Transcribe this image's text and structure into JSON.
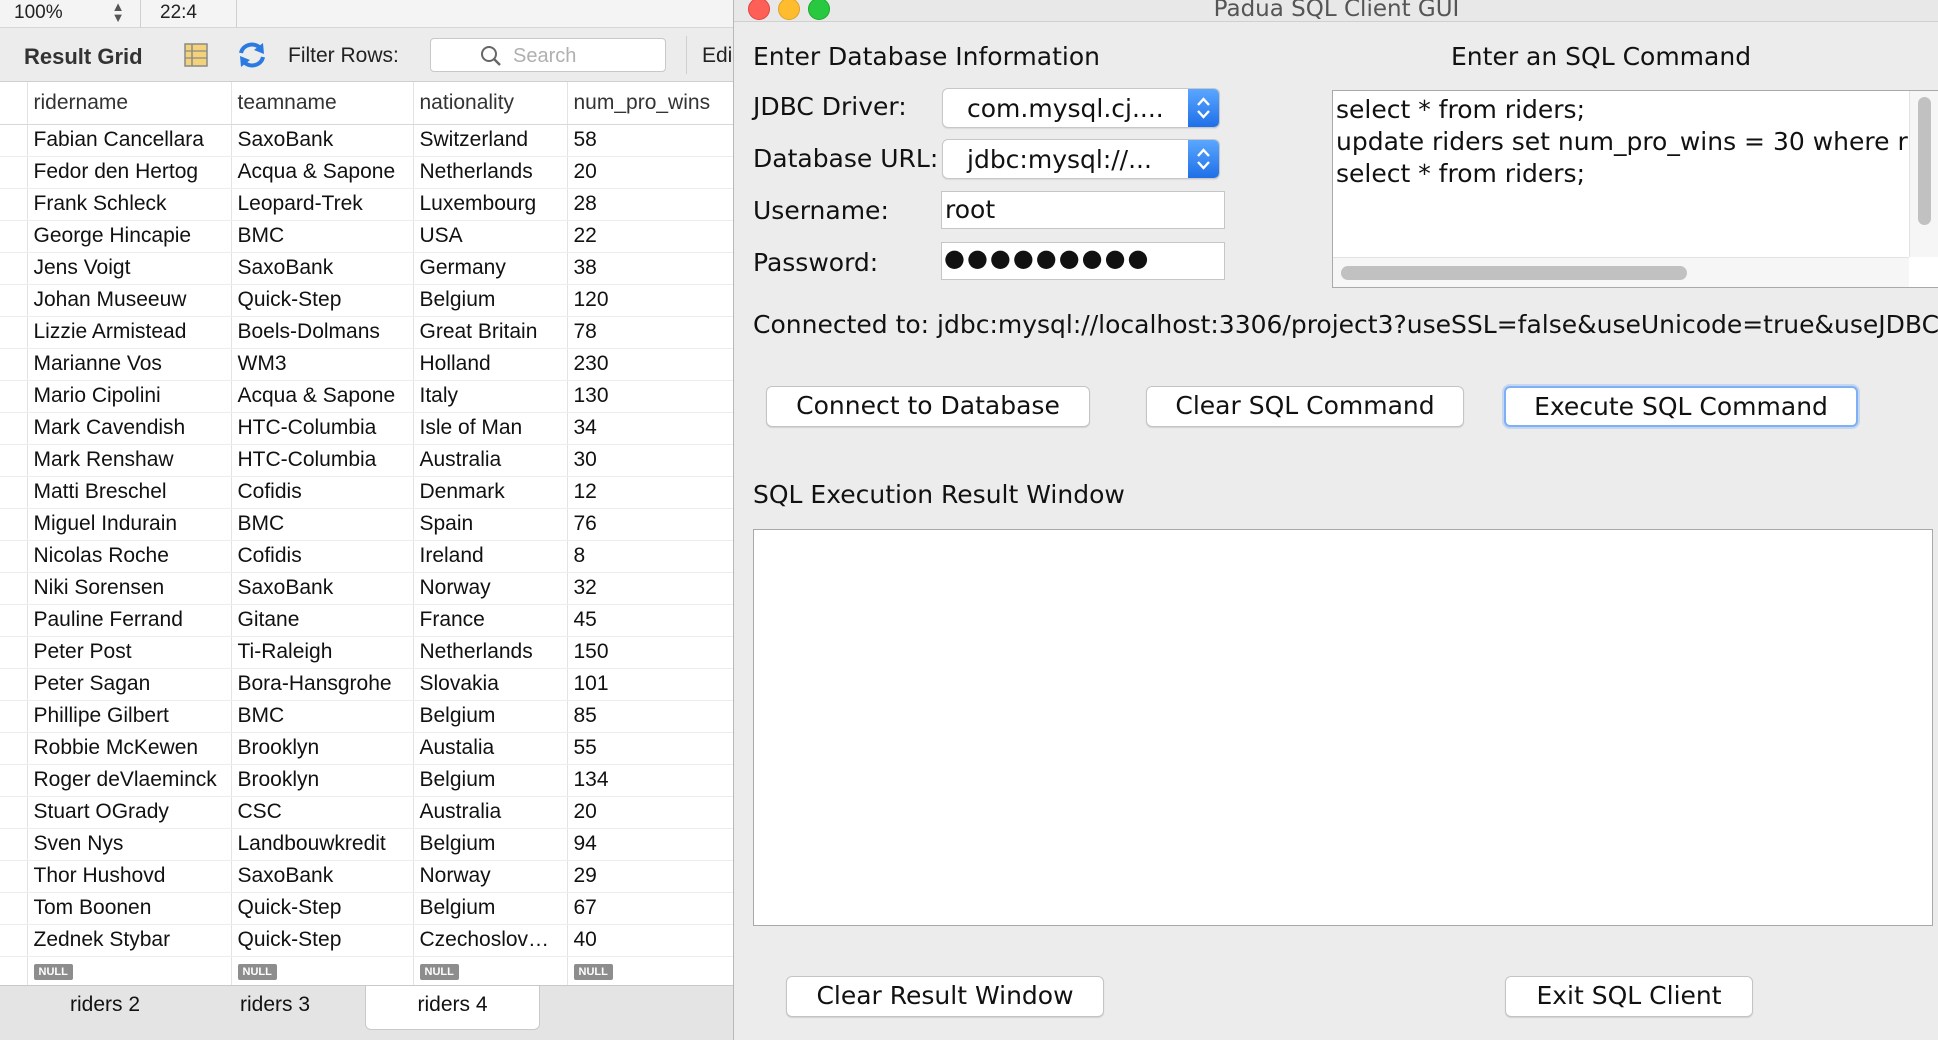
{
  "workbench": {
    "zoom": "100%",
    "cursor_pos": "22:4",
    "toolbar": {
      "result_grid_label": "Result Grid",
      "filter_rows_label": "Filter Rows:",
      "search_placeholder": "Search",
      "edit_label": "Edi"
    },
    "columns": [
      "ridername",
      "teamname",
      "nationality",
      "num_pro_wins"
    ],
    "rows": [
      [
        "Fabian Cancellara",
        "SaxoBank",
        "Switzerland",
        "58"
      ],
      [
        "Fedor den Hertog",
        "Acqua & Sapone",
        "Netherlands",
        "20"
      ],
      [
        "Frank Schleck",
        "Leopard-Trek",
        "Luxembourg",
        "28"
      ],
      [
        "George Hincapie",
        "BMC",
        "USA",
        "22"
      ],
      [
        "Jens Voigt",
        "SaxoBank",
        "Germany",
        "38"
      ],
      [
        "Johan Museeuw",
        "Quick-Step",
        "Belgium",
        "120"
      ],
      [
        "Lizzie Armistead",
        "Boels-Dolmans",
        "Great Britain",
        "78"
      ],
      [
        "Marianne Vos",
        "WM3",
        "Holland",
        "230"
      ],
      [
        "Mario Cipolini",
        "Acqua & Sapone",
        "Italy",
        "130"
      ],
      [
        "Mark Cavendish",
        "HTC-Columbia",
        "Isle of Man",
        "34"
      ],
      [
        "Mark Renshaw",
        "HTC-Columbia",
        "Australia",
        "30"
      ],
      [
        "Matti Breschel",
        "Cofidis",
        "Denmark",
        "12"
      ],
      [
        "Miguel Indurain",
        "BMC",
        "Spain",
        "76"
      ],
      [
        "Nicolas Roche",
        "Cofidis",
        "Ireland",
        "8"
      ],
      [
        "Niki Sorensen",
        "SaxoBank",
        "Norway",
        "32"
      ],
      [
        "Pauline Ferrand",
        "Gitane",
        "France",
        "45"
      ],
      [
        "Peter Post",
        "Ti-Raleigh",
        "Netherlands",
        "150"
      ],
      [
        "Peter Sagan",
        "Bora-Hansgrohe",
        "Slovakia",
        "101"
      ],
      [
        "Phillipe Gilbert",
        "BMC",
        "Belgium",
        "85"
      ],
      [
        "Robbie McKewen",
        "Brooklyn",
        "Austalia",
        "55"
      ],
      [
        "Roger deVlaeminck",
        "Brooklyn",
        "Belgium",
        "134"
      ],
      [
        "Stuart OGrady",
        "CSC",
        "Australia",
        "20"
      ],
      [
        "Sven Nys",
        "Landbouwkredit",
        "Belgium",
        "94"
      ],
      [
        "Thor Hushovd",
        "SaxoBank",
        "Norway",
        "29"
      ],
      [
        "Tom Boonen",
        "Quick-Step",
        "Belgium",
        "67"
      ],
      [
        "Zednek Stybar",
        "Quick-Step",
        "Czechoslov…",
        "40"
      ]
    ],
    "null_label": "NULL",
    "tabs": [
      {
        "label": "riders 2",
        "active": false
      },
      {
        "label": "riders 3",
        "active": false
      },
      {
        "label": "riders 4",
        "active": true
      }
    ]
  },
  "client": {
    "window_title": "Padua SQL Client GUI",
    "db_section_title": "Enter Database Information",
    "sql_section_title": "Enter an SQL Command",
    "jdbc_driver_label": "JDBC Driver:",
    "jdbc_driver_value": "com.mysql.cj....",
    "db_url_label": "Database URL:",
    "db_url_value": "jdbc:mysql://...",
    "username_label": "Username:",
    "username_value": "root",
    "password_label": "Password:",
    "password_masked": "●●●●●●●●●",
    "sql_lines": [
      "select * from riders;",
      "update riders set num_pro_wins = 30 where r",
      "select * from riders;"
    ],
    "connection_status": "Connected to: jdbc:mysql://localhost:3306/project3?useSSL=false&useUnicode=true&useJDBC",
    "buttons": {
      "connect": "Connect to Database",
      "clear_sql": "Clear SQL Command",
      "execute_sql": "Execute SQL Command",
      "clear_result": "Clear Result Window",
      "exit": "Exit SQL Client"
    },
    "result_section_title": "SQL Execution Result Window",
    "traffic_lights": {
      "close": "#fe5f57",
      "minimize": "#febc2e",
      "zoom": "#28c840"
    },
    "accent_color": "#1f6fe8"
  }
}
